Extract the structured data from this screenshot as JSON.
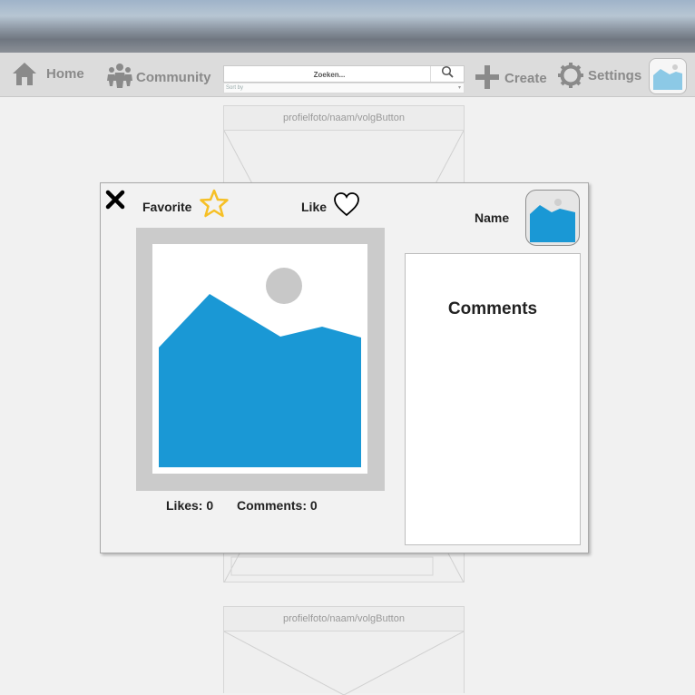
{
  "nav": {
    "home": "Home",
    "community": "Community",
    "create": "Create",
    "settings": "Settings",
    "search_placeholder": "Zoeken...",
    "sort_label": "Sort by"
  },
  "feed": {
    "card_header_1": "profielfoto/naam/volgButton",
    "card_header_2": "profielfoto/naam/volgButton"
  },
  "modal": {
    "favorite_label": "Favorite",
    "like_label": "Like",
    "name_label": "Name",
    "comments_title": "Comments",
    "likes_text": "Likes: 0",
    "comments_count_text": "Comments: 0"
  },
  "icons": {
    "close": "close-icon",
    "favorite": "star-icon",
    "like": "heart-icon",
    "home": "home-icon",
    "community": "people-icon",
    "create": "plus-icon",
    "settings": "gear-icon",
    "search": "search-icon"
  },
  "colors": {
    "image_blue": "#1a98d5",
    "star": "#f6c026",
    "navbar_bg": "#dcdcdc"
  }
}
